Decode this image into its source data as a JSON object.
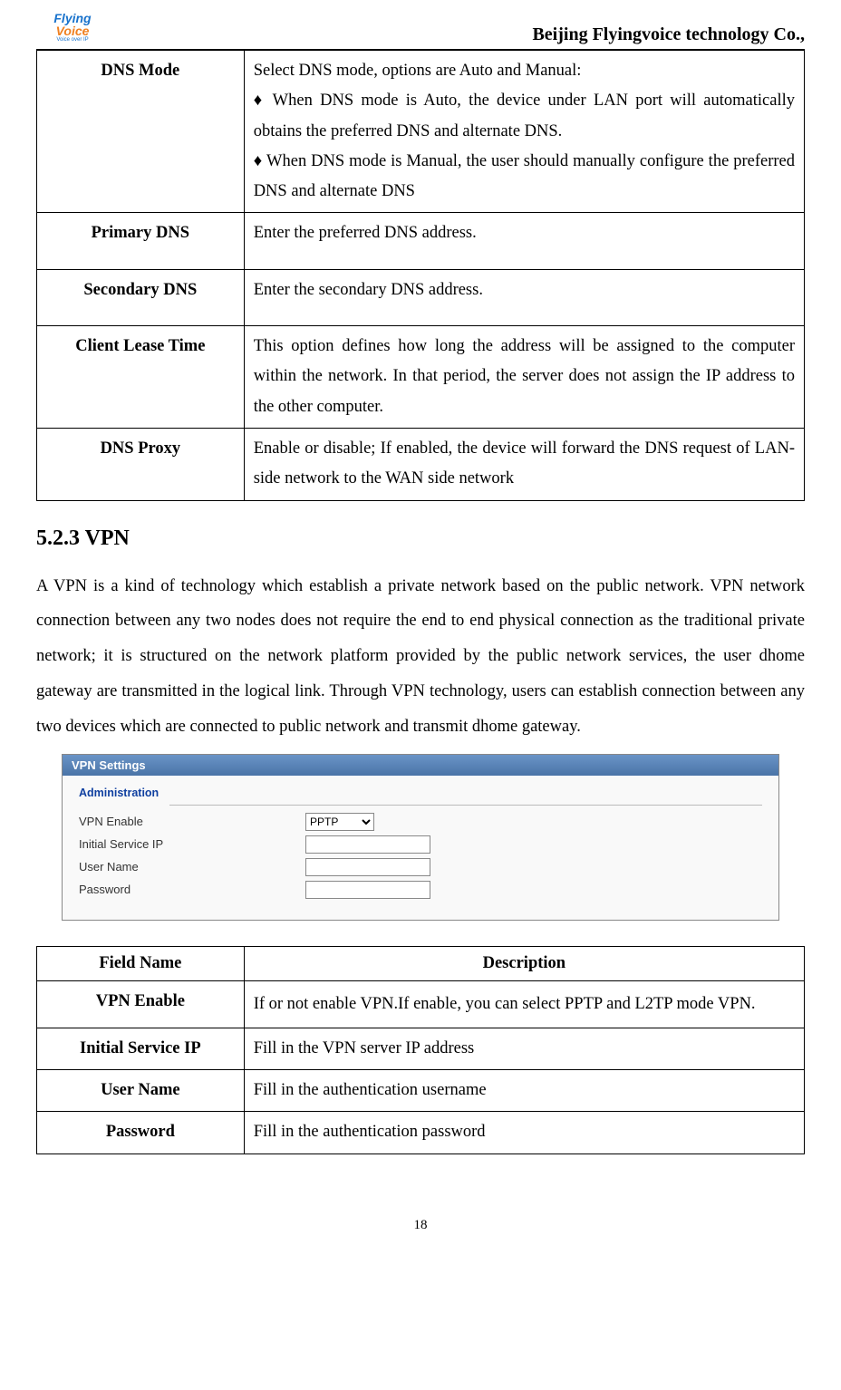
{
  "header": {
    "logo_top": "Flying",
    "logo_bottom": "Voice",
    "logo_sub": "Voice over IP",
    "company": "Beijing Flyingvoice technology Co.,"
  },
  "table1": {
    "rows": [
      {
        "label": "DNS Mode",
        "desc": "Select DNS mode, options are Auto and Manual:\n♦ When DNS mode is Auto, the device under LAN port will automatically obtains the preferred DNS and alternate DNS.\n♦ When DNS mode is Manual, the user should manually configure the preferred DNS and alternate DNS"
      },
      {
        "label": "Primary DNS",
        "desc": "Enter the preferred DNS address."
      },
      {
        "label": "Secondary DNS",
        "desc": "Enter the secondary DNS address."
      },
      {
        "label": "Client Lease Time",
        "desc": "This option defines how long the address will be assigned to the computer within the network. In that period, the server does not assign the IP address to the other computer."
      },
      {
        "label": "DNS Proxy",
        "desc": "Enable or disable; If enabled, the device will forward the DNS request of LAN-side network to the WAN side network"
      }
    ]
  },
  "section": {
    "heading": "5.2.3 VPN",
    "paragraph": "A VPN is a kind of technology which establish a private network based on the public network. VPN network connection between any two nodes does not require the end to end physical connection as the traditional private network; it is structured on the network platform provided by the public network services, the user dhome gateway are transmitted in the logical link. Through VPN technology, users can establish connection between any two devices which are connected to public network and transmit dhome gateway."
  },
  "screenshot": {
    "title": "VPN Settings",
    "fieldset": "Administration",
    "fields": {
      "vpn_enable_label": "VPN Enable",
      "vpn_enable_value": "PPTP",
      "initial_ip_label": "Initial Service IP",
      "initial_ip_value": "",
      "username_label": "User Name",
      "username_value": "",
      "password_label": "Password",
      "password_value": ""
    }
  },
  "table2": {
    "headers": {
      "col1": "Field Name",
      "col2": "Description"
    },
    "rows": [
      {
        "label": "VPN Enable",
        "desc": "If or not enable VPN.If enable, you can select PPTP and L2TP mode VPN."
      },
      {
        "label": "Initial Service IP",
        "desc": "Fill in the VPN server IP address"
      },
      {
        "label": "User Name",
        "desc": "Fill in the authentication username"
      },
      {
        "label": "Password",
        "desc": "Fill in the authentication password"
      }
    ]
  },
  "page_number": "18"
}
